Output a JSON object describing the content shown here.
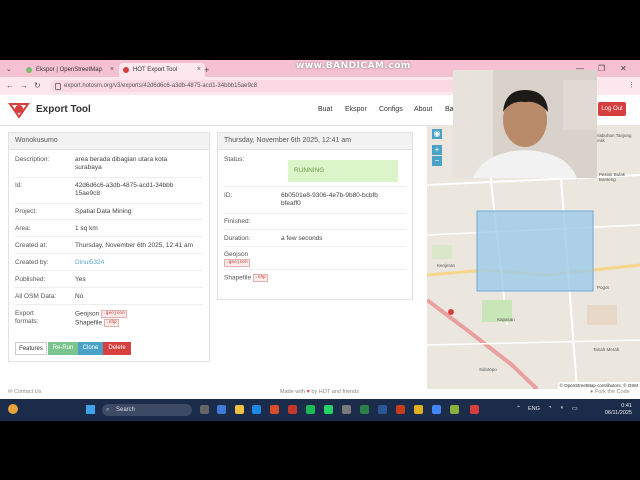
{
  "browser": {
    "tabs": [
      {
        "label": "Ekspor | OpenStreetMap"
      },
      {
        "label": "HOT Export Tool"
      }
    ],
    "new_tab": "+",
    "url": "export.hotosm.org/v3/exports/42d6d6c6-a3db-4875-acd1-34bbb15ae9c8",
    "recorder_watermark": "www.BANDICAM.com",
    "menu_glyph": "⌄",
    "back_glyph": "←",
    "forward_glyph": "→",
    "reload_glyph": "↻",
    "minimize_glyph": "—",
    "restore_glyph": "❐",
    "close_glyph": "✕",
    "more_glyph": "⋮"
  },
  "app": {
    "title": "Export Tool",
    "nav": [
      "Buat",
      "Ekspor",
      "Configs",
      "About",
      "Ba"
    ],
    "logout": "Log Out",
    "brand_color": "#d73f3f"
  },
  "details": {
    "header": "Wonokusumo",
    "rows": [
      {
        "label": "Description:",
        "value": "area berada dibagian utara kota surabaya"
      },
      {
        "label": "Id:",
        "value": "42d6d6c6-a3db-4875-acd1-34bbb15ae9c8"
      },
      {
        "label": "Project:",
        "value": "Spatial Data Mining"
      },
      {
        "label": "Area:",
        "value": "1 sq km"
      },
      {
        "label": "Created at:",
        "value": "Thursday, November 6th 2025, 12:41 am"
      },
      {
        "label": "Created by:",
        "value": "Dinul5324"
      },
      {
        "label": "Published:",
        "value": "Yes"
      },
      {
        "label": "All OSM Data:",
        "value": "No"
      },
      {
        "label": "Export formats:",
        "formats": [
          {
            "name": "Geojson",
            "ext": ".geojson"
          },
          {
            "name": "Shapefile",
            "ext": ".shp"
          }
        ]
      }
    ],
    "buttons": [
      "Features",
      "Re-Run",
      "Clone",
      "Delete"
    ]
  },
  "run": {
    "header": "Thursday, November 6th 2025, 12:41 am",
    "status_label": "Status:",
    "status_value": "RUNNING",
    "id_label": "ID:",
    "id_value": "6b0501e8-9306-4e7b-9b80-bcbfbbfeaff0",
    "finished_label": "Finished:",
    "duration_label": "Duration:",
    "duration_value": "a few seconds",
    "files": [
      {
        "name": "Geojson",
        "ext": ".geojson"
      },
      {
        "name": "Shapefile",
        "ext": ".shp"
      }
    ]
  },
  "map": {
    "labels": [
      "Pelabuhan Tanjung Perak",
      "Pesisir Bulak Banteng",
      "Pogot",
      "Tanah Merah",
      "Kapasan",
      "Kenjeran",
      "Sidotopo"
    ],
    "attribution": "© OpenStreetMap contributors, © OSM",
    "controls": [
      "◉",
      "+",
      "−"
    ]
  },
  "footer": {
    "contact": "Contact Us",
    "made_with_prefix": "Made with",
    "made_with_suffix": "by HOT and friends",
    "fork": "Fork the Code"
  },
  "taskbar": {
    "search_placeholder": "Search",
    "language": "ENG",
    "time": "0:41",
    "date": "06/11/2025"
  }
}
